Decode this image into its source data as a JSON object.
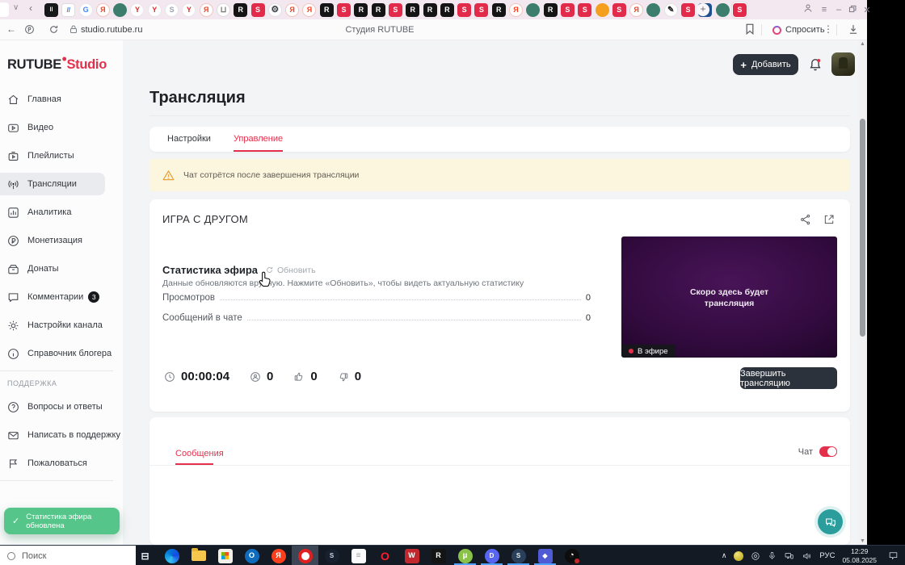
{
  "browser": {
    "page_title": "Студия RUTUBE",
    "url": "studio.rutube.ru",
    "ask_label": "Спросить",
    "tabs": [
      "bars",
      "stripes",
      "google",
      "ya",
      "green",
      "y",
      "y",
      "sgray",
      "y",
      "ya",
      "bag",
      "r",
      "s",
      "gear",
      "ya",
      "ya",
      "r",
      "s",
      "r",
      "r",
      "s",
      "r",
      "r",
      "r",
      "s",
      "s",
      "r",
      "ya",
      "green",
      "r",
      "s",
      "s",
      "orange",
      "s",
      "ya",
      "green",
      "pen",
      "s",
      "vk",
      "green",
      "s-active"
    ]
  },
  "header": {
    "logo_primary": "RUTUBE",
    "logo_secondary": "Studio",
    "add_button": "Добавить"
  },
  "sidebar": {
    "items": [
      {
        "icon": "home",
        "label": "Главная"
      },
      {
        "icon": "video",
        "label": "Видео"
      },
      {
        "icon": "playlist",
        "label": "Плейлисты"
      },
      {
        "icon": "broadcast",
        "label": "Трансляции",
        "active": true
      },
      {
        "icon": "analytics",
        "label": "Аналитика"
      },
      {
        "icon": "ruble",
        "label": "Монетизация"
      },
      {
        "icon": "wallet",
        "label": "Донаты"
      },
      {
        "icon": "comment",
        "label": "Комментарии",
        "badge": "3"
      },
      {
        "icon": "gear",
        "label": "Настройки канала"
      },
      {
        "icon": "info",
        "label": "Справочник блогера"
      }
    ],
    "support_title": "ПОДДЕРЖКА",
    "support_items": [
      {
        "icon": "question",
        "label": "Вопросы и ответы"
      },
      {
        "icon": "mail",
        "label": "Написать в поддержку"
      },
      {
        "icon": "flag",
        "label": "Пожаловаться"
      }
    ]
  },
  "main": {
    "page_title": "Трансляция",
    "tabs": [
      {
        "label": "Настройки",
        "active": false
      },
      {
        "label": "Управление",
        "active": true
      }
    ],
    "warning": "Чат сотрётся после завершения трансляции",
    "stream_title": "ИГРА С ДРУГОМ",
    "stats": {
      "title": "Статистика эфира",
      "refresh_label": "Обновить",
      "hint": "Данные обновляются вручную. Нажмите «Обновить», чтобы видеть актуальную статистику",
      "rows": [
        {
          "label": "Просмотров",
          "value": "0"
        },
        {
          "label": "Сообщений в чате",
          "value": "0"
        }
      ]
    },
    "counters": {
      "duration": "00:00:04",
      "viewers": "0",
      "likes": "0",
      "dislikes": "0"
    },
    "player": {
      "placeholder_line1": "Скоро здесь будет",
      "placeholder_line2": "трансляция",
      "live_badge": "В эфире"
    },
    "end_button": "Завершить трансляцию",
    "chat_panel": {
      "tab": "Сообщения",
      "chat_label": "Чат",
      "chat_on": true
    }
  },
  "toast": "Статистика эфира обновлена",
  "taskbar": {
    "search_placeholder": "Поиск",
    "apps": [
      {
        "name": "task-view",
        "kind": "taskview"
      },
      {
        "name": "edge",
        "kind": "edge"
      },
      {
        "name": "file-explorer",
        "kind": "folder"
      },
      {
        "name": "store",
        "kind": "store"
      },
      {
        "name": "outlook",
        "kind": "outlook"
      },
      {
        "name": "yandex-app",
        "kind": "yared"
      },
      {
        "name": "yandex-browser",
        "kind": "ybro",
        "active": true
      },
      {
        "name": "steam",
        "kind": "steam"
      },
      {
        "name": "notepad",
        "kind": "notepad"
      },
      {
        "name": "opera",
        "kind": "opera"
      },
      {
        "name": "word-red-app",
        "kind": "wred"
      },
      {
        "name": "r-app",
        "kind": "rblack"
      },
      {
        "name": "utorrent",
        "kind": "utorrent",
        "open": true
      },
      {
        "name": "discord",
        "kind": "discord",
        "open": true
      },
      {
        "name": "steam-2",
        "kind": "steam2",
        "open": true
      },
      {
        "name": "blue-app",
        "kind": "bluesq",
        "open": true
      },
      {
        "name": "obs",
        "kind": "obs"
      }
    ],
    "tray_lang": "РУС",
    "tray_time": "12:29",
    "tray_date": "05.08.2025"
  },
  "colors": {
    "accent_red": "#e5304c",
    "dark_button": "#2b323c",
    "toast_green": "#55c589",
    "fab_teal": "#2a9d9c",
    "warning_bg": "#fcf6df",
    "tabstrip_pink": "#f3e7f0",
    "taskbar_dark": "#141a23"
  }
}
